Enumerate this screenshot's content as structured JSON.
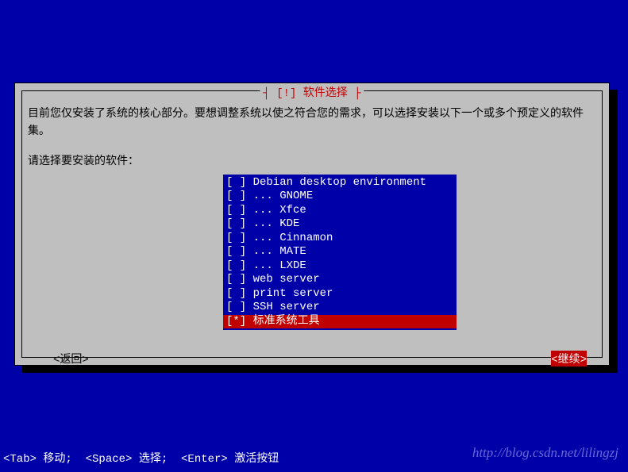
{
  "dialog": {
    "title": "┤ [!] 软件选择 ├",
    "intro": "目前您仅安装了系统的核心部分。要想调整系统以使之符合您的需求，可以选择安装以下一个或多个预定义的软件集。",
    "prompt": "请选择要安装的软件：",
    "items": [
      {
        "checkbox": "[ ]",
        "label": "Debian desktop environment",
        "selected": false
      },
      {
        "checkbox": "[ ]",
        "label": "... GNOME",
        "selected": false
      },
      {
        "checkbox": "[ ]",
        "label": "... Xfce",
        "selected": false
      },
      {
        "checkbox": "[ ]",
        "label": "... KDE",
        "selected": false
      },
      {
        "checkbox": "[ ]",
        "label": "... Cinnamon",
        "selected": false
      },
      {
        "checkbox": "[ ]",
        "label": "... MATE",
        "selected": false
      },
      {
        "checkbox": "[ ]",
        "label": "... LXDE",
        "selected": false
      },
      {
        "checkbox": "[ ]",
        "label": "web server",
        "selected": false
      },
      {
        "checkbox": "[ ]",
        "label": "print server",
        "selected": false
      },
      {
        "checkbox": "[ ]",
        "label": "SSH server",
        "selected": false
      },
      {
        "checkbox": "[*]",
        "label": "标准系统工具",
        "selected": true
      }
    ],
    "back_label": "<返回>",
    "continue_label": "<继续>"
  },
  "statusbar": "<Tab> 移动;  <Space> 选择;  <Enter> 激活按钮",
  "watermark": "http://blog.csdn.net/lilingzj"
}
